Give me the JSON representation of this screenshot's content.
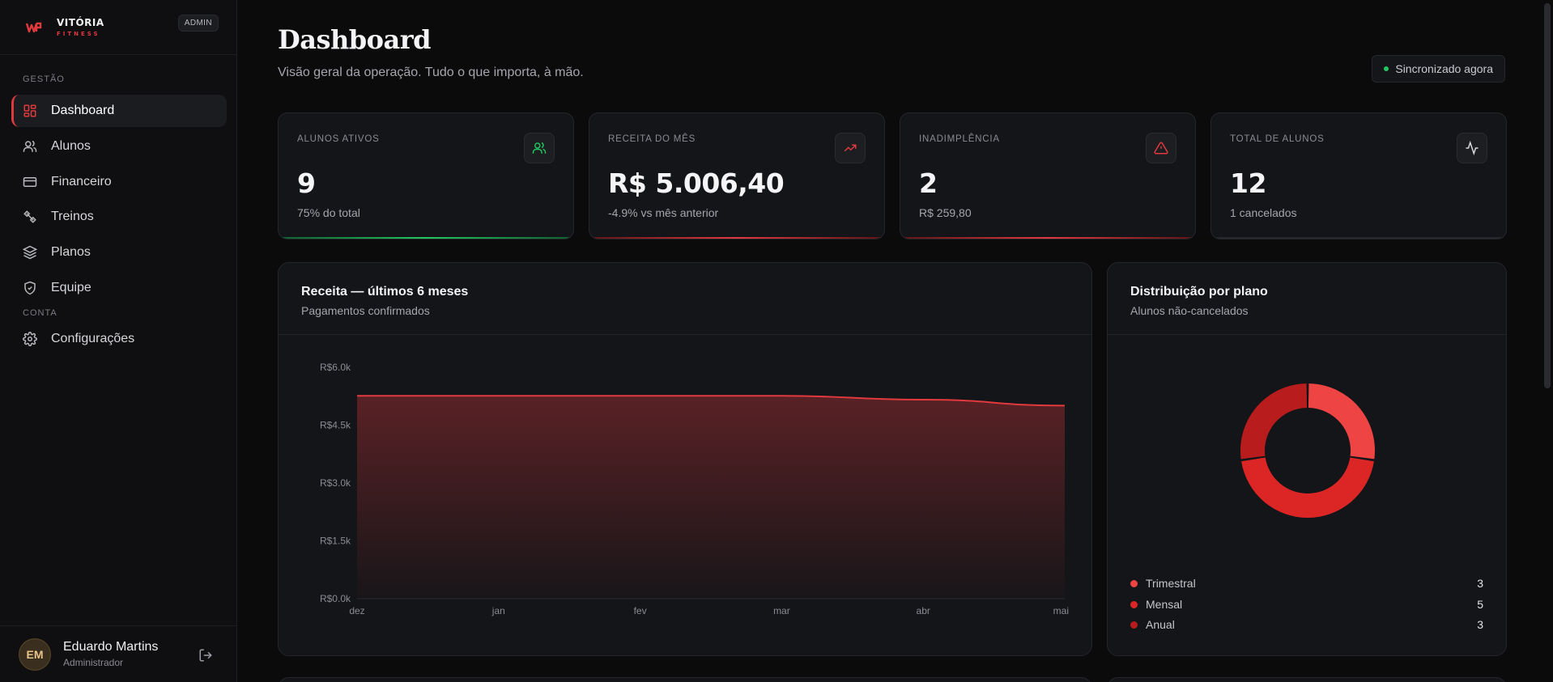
{
  "brand": {
    "name": "VITÓRIA",
    "sub": "FITNESS",
    "badge": "ADMIN"
  },
  "sidebar": {
    "section_gestao": "GESTÃO",
    "section_conta": "CONTA",
    "items": [
      {
        "label": "Dashboard",
        "icon": "dashboard-icon",
        "active": true
      },
      {
        "label": "Alunos",
        "icon": "users-icon"
      },
      {
        "label": "Financeiro",
        "icon": "credit-card-icon"
      },
      {
        "label": "Treinos",
        "icon": "dumbbell-icon"
      },
      {
        "label": "Planos",
        "icon": "layers-icon"
      },
      {
        "label": "Equipe",
        "icon": "shield-icon"
      },
      {
        "label": "Configurações",
        "icon": "gear-icon"
      }
    ]
  },
  "user": {
    "initials": "EM",
    "name": "Eduardo Martins",
    "role": "Administrador"
  },
  "header": {
    "title": "Dashboard",
    "subtitle": "Visão geral da operação. Tudo o que importa, à mão.",
    "sync": "Sincronizado agora"
  },
  "kpis": [
    {
      "label": "ALUNOS ATIVOS",
      "value": "9",
      "sub": "75% do total",
      "icon": "users-icon",
      "accent": "#22c55e"
    },
    {
      "label": "RECEITA DO MÊS",
      "value": "R$ 5.006,40",
      "sub": "-4.9% vs mês anterior",
      "icon": "trending-up-icon",
      "accent": "#e0393e"
    },
    {
      "label": "INADIMPLÊNCIA",
      "value": "2",
      "sub": "R$ 259,80",
      "icon": "alert-triangle-icon",
      "accent": "#e0393e"
    },
    {
      "label": "TOTAL DE ALUNOS",
      "value": "12",
      "sub": "1 cancelados",
      "icon": "activity-icon",
      "accent": "#3a3b40"
    }
  ],
  "revenue_panel": {
    "title": "Receita — últimos 6 meses",
    "subtitle": "Pagamentos confirmados"
  },
  "plan_panel": {
    "title": "Distribuição por plano",
    "subtitle": "Alunos não-cancelados"
  },
  "colors": {
    "accent": "#e0393e",
    "positive": "#22c55e",
    "background": "#0b0b0c",
    "card": "#141518"
  },
  "chart_data": [
    {
      "type": "area",
      "title": "Receita — últimos 6 meses",
      "x": [
        "dez",
        "jan",
        "fev",
        "mar",
        "abr",
        "mai"
      ],
      "values": [
        5260,
        5260,
        5260,
        5260,
        5160,
        5006.4
      ],
      "ylim": [
        0,
        6000
      ],
      "yticks": [
        0,
        1500,
        3000,
        4500,
        6000
      ],
      "ytick_labels": [
        "R$0.0k",
        "R$1.5k",
        "R$3.0k",
        "R$4.5k",
        "R$6.0k"
      ],
      "grid": false
    },
    {
      "type": "pie",
      "title": "Distribuição por plano",
      "donut": true,
      "labels": [
        "Trimestral",
        "Mensal",
        "Anual"
      ],
      "values": [
        3,
        5,
        3
      ],
      "colors": [
        "#ef4444",
        "#dc2626",
        "#b91c1c"
      ]
    }
  ]
}
